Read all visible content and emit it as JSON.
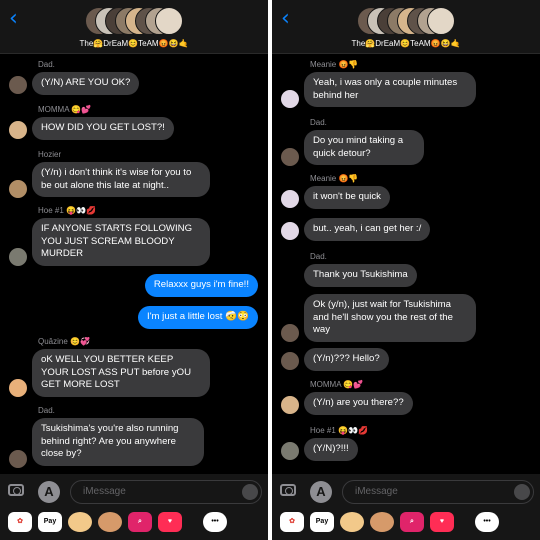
{
  "left": {
    "group_name": "The🤗DrEaM😊TeAM😡😆🤙",
    "messages": [
      {
        "sender": "Dad.",
        "text": "(Y/N) ARE YOU OK?",
        "outgoing": false
      },
      {
        "sender": "MOMMA 😋💕",
        "text": "HOW DID YOU GET LOST?!",
        "outgoing": false
      },
      {
        "sender": "Hozier",
        "text": "(Y/n) i don't think it's wise for you to be out alone this late at night..",
        "outgoing": false
      },
      {
        "sender": "Hoe #1 😝👀💋",
        "text": "IF ANYONE STARTS FOLLOWING YOU JUST SCREAM BLOODY MURDER",
        "outgoing": false
      },
      {
        "sender": "",
        "text": "Relaxxx guys i'm fine!!",
        "outgoing": true
      },
      {
        "sender": "",
        "text": "I'm just a little lost 🤕😳",
        "outgoing": true
      },
      {
        "sender": "Quâzine 😊💞",
        "text": "oK WELL YOU BETTER KEEP YOUR LOST ASS PUT before yOU GET MORE LOST",
        "outgoing": false
      },
      {
        "sender": "Dad.",
        "text": "Tsukishima's you're also running behind right? Are you anywhere close by?",
        "outgoing": false
      }
    ],
    "input_placeholder": "iMessage"
  },
  "right": {
    "group_name": "The🤗DrEaM😊TeAM😡😆🤙",
    "messages": [
      {
        "sender": "Meanie 😡👎",
        "text": "Yeah, i was only a couple minutes behind her",
        "outgoing": false
      },
      {
        "sender": "Dad.",
        "text": "Do you mind taking a quick detour?",
        "outgoing": false
      },
      {
        "sender": "Meanie 😡👎",
        "text": "it won't be quick",
        "outgoing": false
      },
      {
        "sender": "",
        "text": "but.. yeah, i can get her :/",
        "outgoing": false
      },
      {
        "sender": "Dad.",
        "text": "Thank you Tsukishima",
        "outgoing": false
      },
      {
        "sender": "",
        "text": "Ok (y/n), just wait for Tsukishima and he'll show you the rest of the way",
        "outgoing": false
      },
      {
        "sender": "",
        "text": "(Y/n)??? Hello?",
        "outgoing": false
      },
      {
        "sender": "MOMMA 😋💕",
        "text": "(Y/n) are you there??",
        "outgoing": false
      },
      {
        "sender": "Hoe #1 😝👀💋",
        "text": "(Y/N)?!!!",
        "outgoing": false
      }
    ],
    "input_placeholder": "iMessage"
  },
  "app_drawer": [
    "Photos",
    "Pay",
    "Memoji",
    "Memoji",
    "Images",
    "Digital Touch",
    "More"
  ],
  "icons": [
    "back-chevron-icon",
    "camera-icon",
    "app-store-icon",
    "audio-waveform-icon"
  ],
  "colors": {
    "background": "#000000",
    "bar": "#161616",
    "incoming_bubble": "#3a3a3c",
    "outgoing_bubble": "#0a84ff",
    "accent": "#0a84ff"
  }
}
